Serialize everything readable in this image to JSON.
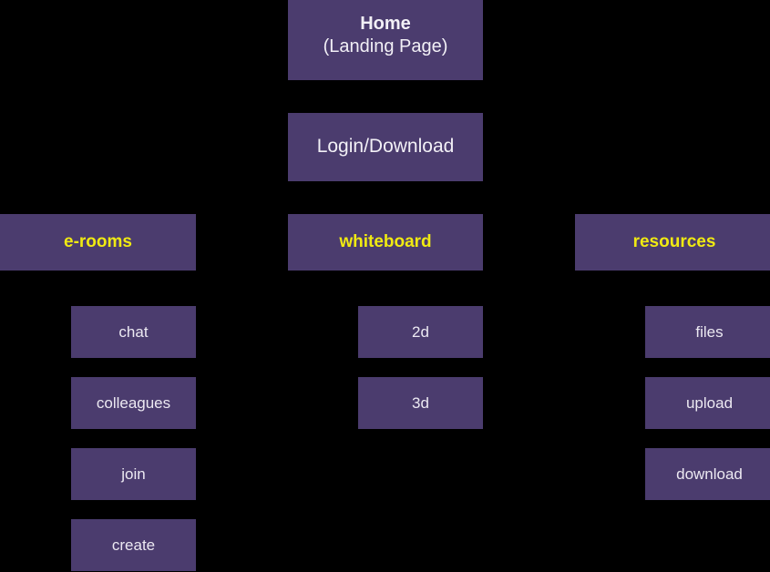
{
  "diagram": {
    "type": "sitemap-tree",
    "background_color": "#000000",
    "node_color": "#4b3c6e",
    "node_text_color": "#f2f0f6",
    "section_text_color": "#f0ea12",
    "root": {
      "title": "Home",
      "subtitle": "(Landing Page)"
    },
    "gate": {
      "label": "Login/Download"
    },
    "sections": [
      {
        "label": "e-rooms",
        "children": [
          {
            "label": "chat"
          },
          {
            "label": "colleagues"
          },
          {
            "label": "join"
          },
          {
            "label": "create"
          }
        ]
      },
      {
        "label": "whiteboard",
        "children": [
          {
            "label": "2d"
          },
          {
            "label": "3d"
          }
        ]
      },
      {
        "label": "resources",
        "children": [
          {
            "label": "files"
          },
          {
            "label": "upload"
          },
          {
            "label": "download"
          }
        ]
      }
    ]
  }
}
